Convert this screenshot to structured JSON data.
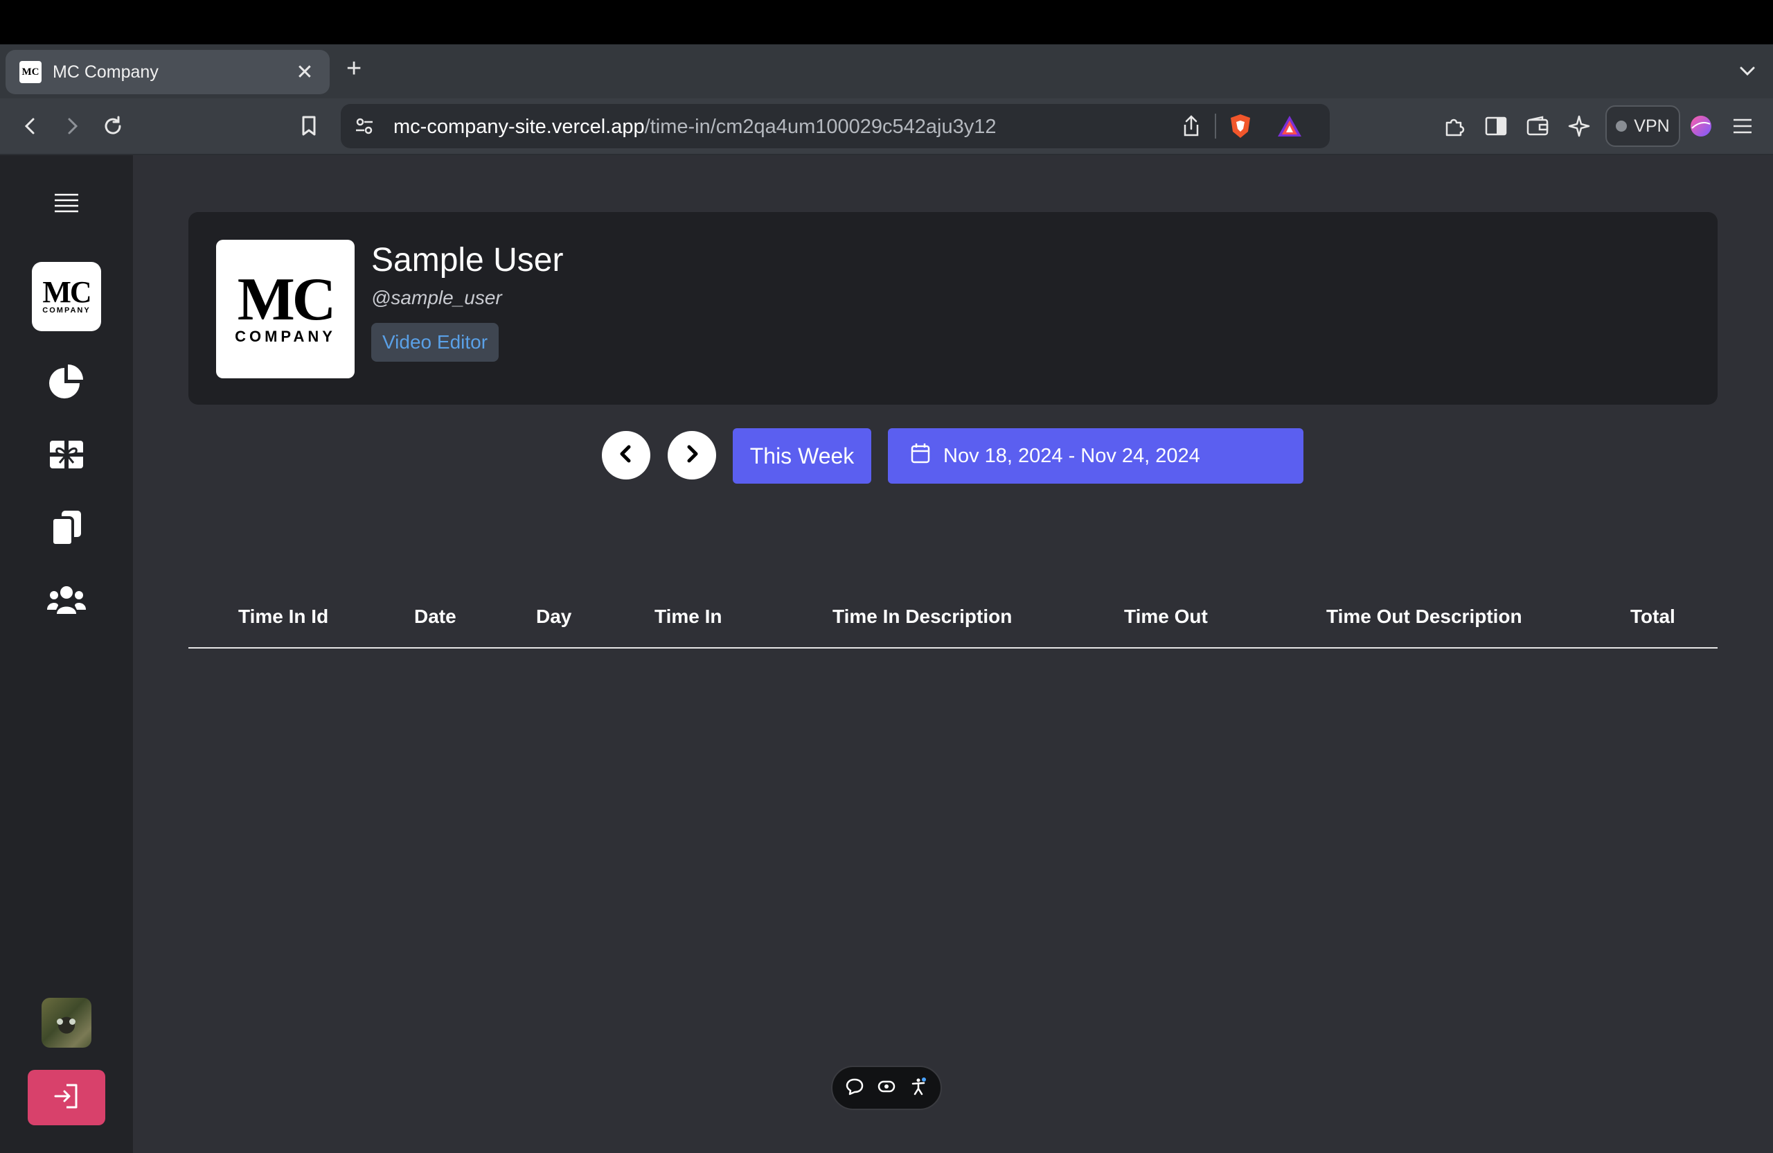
{
  "browser": {
    "tab_title": "MC Company",
    "tab_favicon_text": "MC",
    "url_domain": "mc-company-site.vercel.app",
    "url_path": "/time-in/cm2qa4um100029c542aju3y12",
    "vpn_label": "VPN"
  },
  "sidebar": {
    "logo_mc": "MC",
    "logo_company": "COMPANY",
    "items": [
      {
        "icon": "menu-icon"
      },
      {
        "icon": "pie-chart-icon"
      },
      {
        "icon": "gift-icon"
      },
      {
        "icon": "copy-icon"
      },
      {
        "icon": "users-icon"
      }
    ],
    "logout_icon": "logout-icon"
  },
  "profile": {
    "logo_mc": "MC",
    "logo_company": "COMPANY",
    "name": "Sample User",
    "handle": "@sample_user",
    "role": "Video Editor"
  },
  "week_nav": {
    "this_week_label": "This Week",
    "date_range": "Nov 18, 2024 - Nov 24, 2024"
  },
  "table": {
    "columns": [
      "Time In Id",
      "Date",
      "Day",
      "Time In",
      "Time In Description",
      "Time Out",
      "Time Out Description",
      "Total"
    ],
    "rows": []
  },
  "colors": {
    "accent": "#5b5ff0",
    "logout": "#d8416b",
    "role_text": "#5aa0e6",
    "background": "#2f3036",
    "sidebar": "#222327",
    "card": "#1f2024"
  }
}
